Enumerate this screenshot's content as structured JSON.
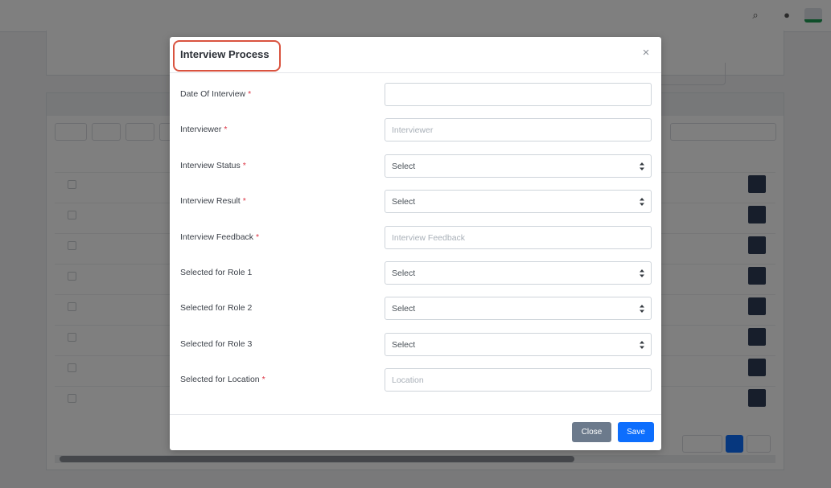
{
  "modal": {
    "title": "Interview Process",
    "close_icon": "close-icon",
    "fields": [
      {
        "label": "Date Of Interview",
        "required": "*",
        "type": "input",
        "value": "",
        "placeholder": ""
      },
      {
        "label": "Interviewer",
        "required": "*",
        "type": "input",
        "value": "",
        "placeholder": "Interviewer"
      },
      {
        "label": "Interview Status",
        "required": "*",
        "type": "select",
        "value": "Select"
      },
      {
        "label": "Interview Result",
        "required": "*",
        "type": "select",
        "value": "Select"
      },
      {
        "label": "Interview Feedback",
        "required": "*",
        "type": "input",
        "value": "",
        "placeholder": "Interview Feedback"
      },
      {
        "label": "Selected for Role 1",
        "required": "",
        "type": "select",
        "value": "Select"
      },
      {
        "label": "Selected for Role 2",
        "required": "",
        "type": "select",
        "value": "Select"
      },
      {
        "label": "Selected for Role 3",
        "required": "",
        "type": "select",
        "value": "Select"
      },
      {
        "label": "Selected for Location",
        "required": "*",
        "type": "input",
        "value": "",
        "placeholder": "Location"
      }
    ],
    "footer": {
      "close_label": "Close",
      "save_label": "Save"
    }
  },
  "colors": {
    "primary": "#0d6efd",
    "secondary": "#6c7a8c",
    "required": "#dc3545",
    "highlight": "#d9533f"
  }
}
